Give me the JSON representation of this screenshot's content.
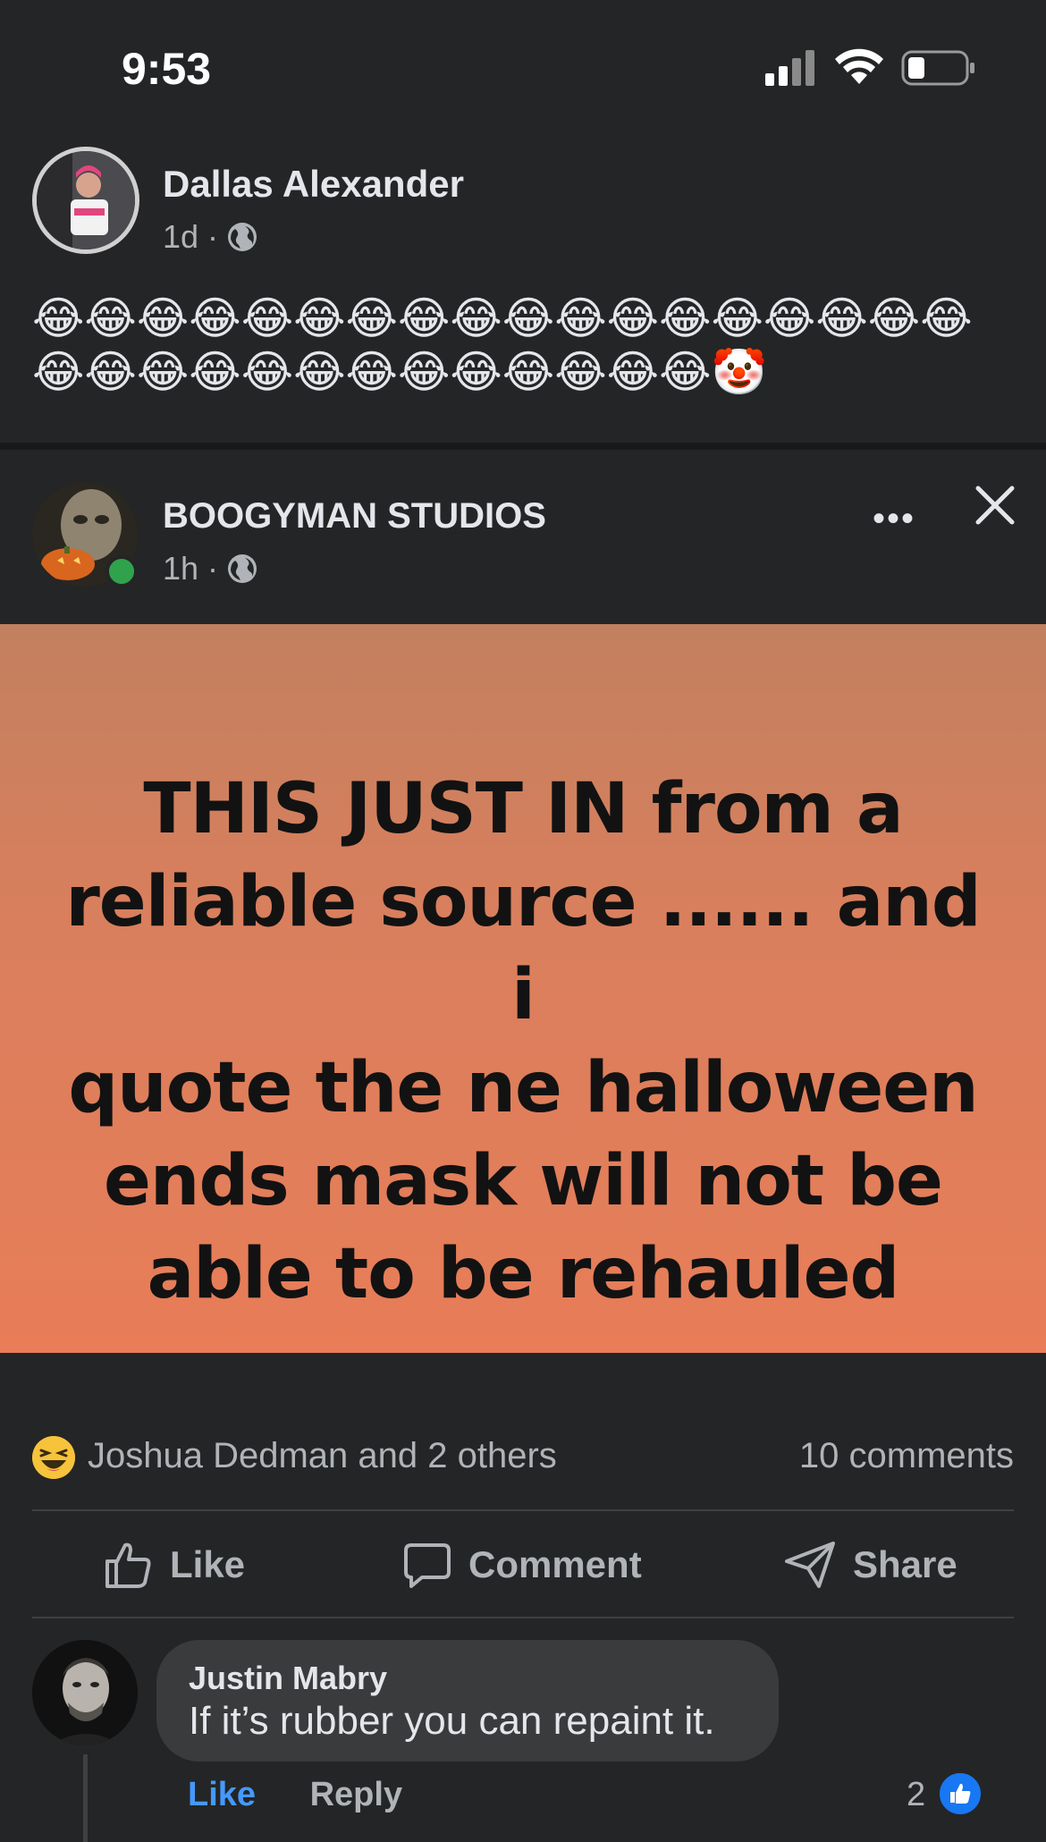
{
  "status_bar": {
    "time": "9:53"
  },
  "post1": {
    "author": "Dallas Alexander",
    "time": "1d",
    "separator": "·",
    "emoji_line1": "😂😂😂😂😂😂😂😂😂😂😂😂😂😂😂😂😂😂",
    "emoji_line2": "😂😂😂😂😂😂😂😂😂😂😂😂😂🤡"
  },
  "post2": {
    "author": "BOOGYMAN STUDIOS",
    "time": "1h",
    "separator": "·",
    "more_label": "•••",
    "image_text": "THIS JUST IN  from a\nreliable source ...... and i\nquote  the ne halloween\nends mask will not be\nable to be rehauled",
    "reactions_text": "Joshua Dedman and 2 others",
    "comments_count": "10 comments",
    "actions": {
      "like": "Like",
      "comment": "Comment",
      "share": "Share"
    }
  },
  "comment": {
    "author": "Justin Mabry",
    "text": "If it’s rubber you can repaint it.",
    "like_label": "Like",
    "reply_label": "Reply",
    "reaction_count": "2"
  },
  "colors": {
    "background": "#242526",
    "secondary_text": "#b0b3b8",
    "link_blue": "#4599ff",
    "online_green": "#31a24c",
    "image_gradient_top": "#c2805f",
    "image_gradient_bottom": "#e87d58"
  },
  "icons": [
    "signal-icon",
    "wifi-icon",
    "battery-icon",
    "globe-icon",
    "more-icon",
    "close-icon",
    "haha-reaction-icon",
    "like-icon",
    "comment-icon",
    "share-icon",
    "like-badge-icon"
  ]
}
